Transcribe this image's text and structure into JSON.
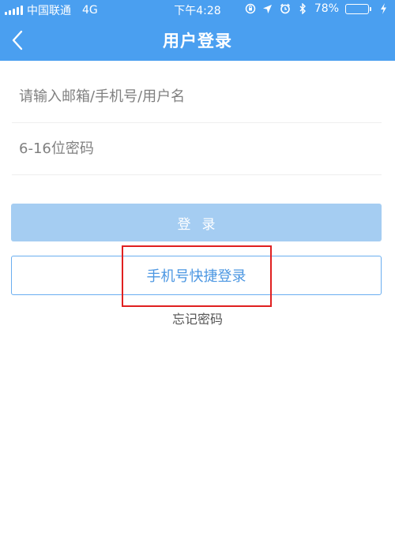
{
  "status_bar": {
    "carrier": "中国联通",
    "network": "4G",
    "time": "下午4:28",
    "battery_text": "78%",
    "battery_level": 0.78,
    "icons": [
      "orientation-lock-icon",
      "location-icon",
      "alarm-icon",
      "bluetooth-icon",
      "charging-icon"
    ]
  },
  "header": {
    "title": "用户登录",
    "back_icon": "chevron-left-icon"
  },
  "form": {
    "account_placeholder": "请输入邮箱/手机号/用户名",
    "account_value": "",
    "password_placeholder": "6-16位密码",
    "password_value": ""
  },
  "buttons": {
    "login_label": "登录",
    "quick_login_label": "手机号快捷登录"
  },
  "links": {
    "forgot_password": "忘记密码"
  },
  "colors": {
    "header_bg": "#4a9ff0",
    "login_button_bg": "#a5cdf2",
    "quick_login_border": "#6aaef0",
    "quick_login_text": "#4c97e2",
    "highlight_border": "#e02020"
  }
}
